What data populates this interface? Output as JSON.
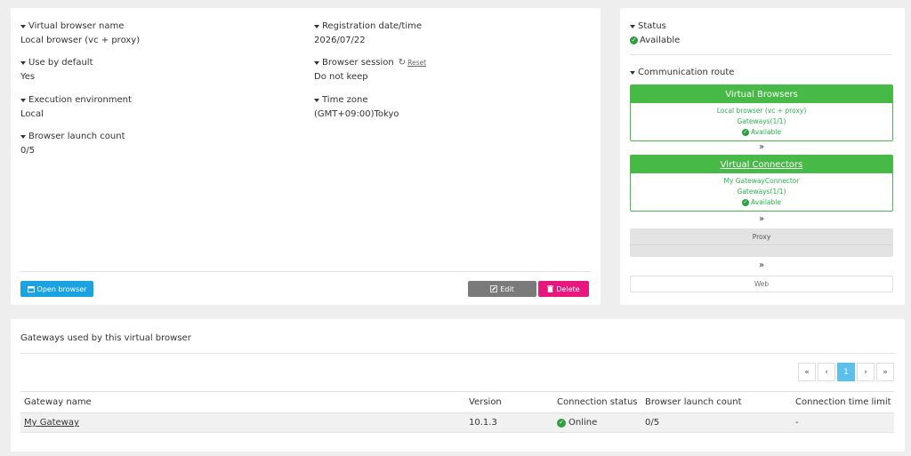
{
  "details": {
    "fields": [
      {
        "label": "Virtual browser name",
        "value": "Local browser (vc + proxy)"
      },
      {
        "label": "Use by default",
        "value": "Yes"
      },
      {
        "label": "Execution environment",
        "value": "Local"
      },
      {
        "label": "Browser launch count",
        "value": "0/5"
      },
      {
        "label": "Registration date/time",
        "value": "2026/07/22"
      },
      {
        "label": "Browser session",
        "value": "Do not keep",
        "action": "Reset"
      },
      {
        "label": "Time zone",
        "value": "(GMT+09:00)Tokyo"
      }
    ],
    "buttons": {
      "open_browser": "Open browser",
      "edit": "Edit",
      "delete": "Delete"
    }
  },
  "route": {
    "status_label": "Status",
    "status_value": "Available",
    "comm_label": "Communication route",
    "virtual_browsers": {
      "title": "Virtual Browsers",
      "name": "Local browser (vc + proxy)",
      "gateways": "Gateways(1/1)",
      "status": "Available"
    },
    "virtual_connectors": {
      "title": "Virtual Connectors",
      "name": "My GatewayConnector",
      "gateways": "Gateways(1/1)",
      "status": "Available"
    },
    "proxy": "Proxy",
    "web": "Web",
    "chevron": "»"
  },
  "gateways": {
    "title": "Gateways used by this virtual browser",
    "pager": {
      "first": "«",
      "prev": "‹",
      "current": "1",
      "next": "›",
      "last": "»"
    },
    "columns": [
      "Gateway name",
      "Version",
      "Connection status",
      "Browser launch count",
      "Connection time limit"
    ],
    "rows": [
      {
        "name": "My Gateway",
        "version": "10.1.3",
        "status": "Online",
        "launch_count": "0/5",
        "time_limit": "-"
      }
    ]
  },
  "colors": {
    "primary_blue": "#1aa3e0",
    "edit_gray": "#7a7a7a",
    "delete_pink": "#e8177d",
    "route_green": "#47b947",
    "status_green": "#2e9e3f",
    "pager_active": "#5bc0eb"
  },
  "icons": {
    "caret": "caret-down-icon",
    "reset": "refresh-icon",
    "status": "check-circle-icon",
    "open_browser": "window-icon",
    "edit": "pencil-icon",
    "delete": "trash-icon",
    "chevron": "double-chevron-down-icon"
  }
}
